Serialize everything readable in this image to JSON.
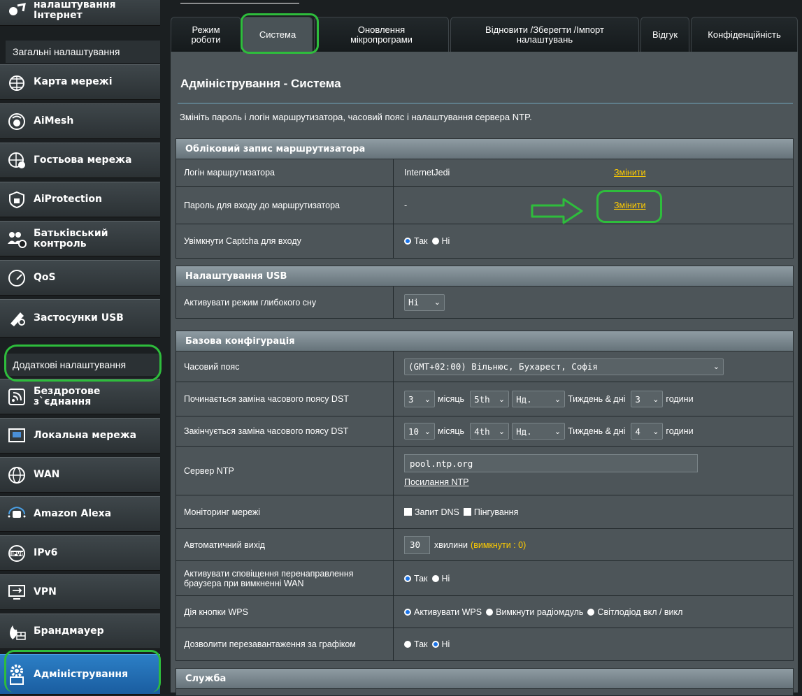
{
  "sidebar": {
    "top_partial": "налаштування Інтернет",
    "section_general": "Загальні налаштування",
    "general_items": [
      {
        "label": "Карта мережі",
        "icon": "network-map-icon"
      },
      {
        "label": "AiMesh",
        "icon": "aimesh-icon"
      },
      {
        "label": "Гостьова мережа",
        "icon": "guest-network-icon"
      },
      {
        "label": "AiProtection",
        "icon": "shield-icon"
      },
      {
        "label": "Батьківський контроль",
        "icon": "parental-control-icon"
      },
      {
        "label": "QoS",
        "icon": "speedometer-icon"
      },
      {
        "label": "Застосунки USB",
        "icon": "usb-apps-icon"
      }
    ],
    "section_advanced": "Додаткові налаштування",
    "advanced_items": [
      {
        "label": "Бездротове з`єднання",
        "icon": "wireless-icon"
      },
      {
        "label": "Локальна мережа",
        "icon": "lan-icon"
      },
      {
        "label": "WAN",
        "icon": "globe-icon"
      },
      {
        "label": "Amazon Alexa",
        "icon": "alexa-icon"
      },
      {
        "label": "IPv6",
        "icon": "ipv6-icon"
      },
      {
        "label": "VPN",
        "icon": "vpn-icon"
      },
      {
        "label": "Брандмауер",
        "icon": "firewall-icon"
      },
      {
        "label": "Адміністрування",
        "icon": "admin-gear-icon"
      }
    ]
  },
  "tabs": [
    "Режим роботи",
    "Система",
    "Оновлення мікропрограми",
    "Відновити /Зберегти /Імпорт налаштувань",
    "Відгук",
    "Конфіденційність"
  ],
  "selected_tab": "Система",
  "page": {
    "title": "Адміністрування - Система",
    "description": "Змініть пароль і логін маршрутизатора, часовий пояс і налаштування сервера NTP."
  },
  "account": {
    "header": "Обліковий запис маршрутизатора",
    "login_label": "Логін маршрутизатора",
    "login_value": "InternetJedi",
    "change_link": "Змінити",
    "password_label": "Пароль для входу до маршрутизатора",
    "password_value": "-",
    "captcha_label": "Увімкнути Captcha для входу",
    "yes": "Так",
    "no": "Ні"
  },
  "usb": {
    "header": "Налаштування USB",
    "deep_sleep_label": "Активувати режим глибокого сну",
    "deep_sleep_value": "Hi"
  },
  "basic": {
    "header": "Базова конфігурація",
    "timezone_label": "Часовий пояс",
    "timezone_value": "(GMT+02:00) Вільнюс, Бухарест, Софія",
    "dst_start_label": "Починається заміна часового поясу DST",
    "dst_start": {
      "month": "3",
      "week": "5th",
      "day": "Нд.",
      "hour": "3"
    },
    "dst_end_label": "Закінчується заміна часового поясу DST",
    "dst_end": {
      "month": "10",
      "week": "4th",
      "day": "Нд.",
      "hour": "4"
    },
    "month_word": "місяць",
    "weekday_word": "Тиждень & дні",
    "hours_word": "години",
    "ntp_label": "Сервер NTP",
    "ntp_value": "pool.ntp.org",
    "ntp_link": "Посилання NTP",
    "monitor_label": "Моніторинг мережі",
    "monitor_dns": "Запит DNS",
    "monitor_ping": "Пінгування",
    "autologout_label": "Автоматичний вихід",
    "autologout_value": "30",
    "autologout_unit": "хвилини",
    "autologout_hint": "(вимкнути : 0)",
    "redirect_label": "Активувати сповіщення перенаправлення браузера при вимкненні WAN",
    "wps_label": "Дія кнопки WPS",
    "wps_opt1": "Активувати WPS",
    "wps_opt2": "Вимкнути радіомдуль",
    "wps_opt3": "Світлодіод вкл / викл",
    "reboot_label": "Дозволити перезавантаження за графіком"
  },
  "service": {
    "header": "Служба"
  },
  "highlight_color": "#2ebd3c",
  "link_color": "#ffcc00"
}
